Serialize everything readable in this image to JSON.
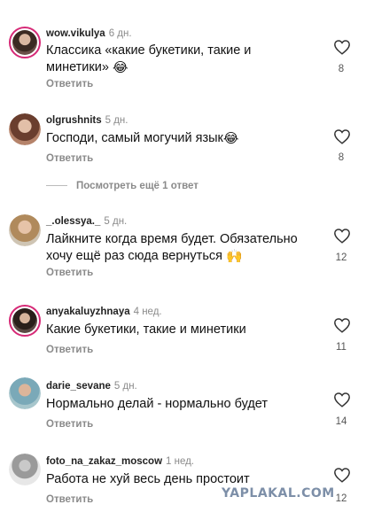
{
  "reply_label": "Ответить",
  "view_more_replies": "Посмотреть ещё 1 ответ",
  "watermark": "YAPLAKAL.COM",
  "comments": [
    {
      "username": "wow.vikulya",
      "time": "6 дн.",
      "text": "Классика «какие букетики, такие и минетики»",
      "emoji": "😂",
      "likes": "8"
    },
    {
      "username": "olgrushnits",
      "time": "5 дн.",
      "text": "Господи, самый могучий язык",
      "emoji": "😂",
      "likes": "8"
    },
    {
      "username": "_.olessya._",
      "time": "5 дн.",
      "text": "Лайкните когда время будет. Обязательно хочу ещё раз сюда вернуться",
      "emoji": "🙌",
      "likes": "12"
    },
    {
      "username": "anyakaluyzhnaya",
      "time": "4 нед.",
      "text": "Какие букетики, такие и минетики",
      "emoji": "",
      "likes": "11"
    },
    {
      "username": "darie_sevane",
      "time": "5 дн.",
      "text": "Нормально делай - нормально будет",
      "emoji": "",
      "likes": "14"
    },
    {
      "username": "foto_na_zakaz_moscow",
      "time": "1 нед.",
      "text": "Работа не хуй весь день простоит",
      "emoji": "",
      "likes": "12"
    }
  ],
  "colors": {
    "story_ring": "#d62976",
    "watermark": "#7d8fa8",
    "muted": "#8a8a8a"
  }
}
